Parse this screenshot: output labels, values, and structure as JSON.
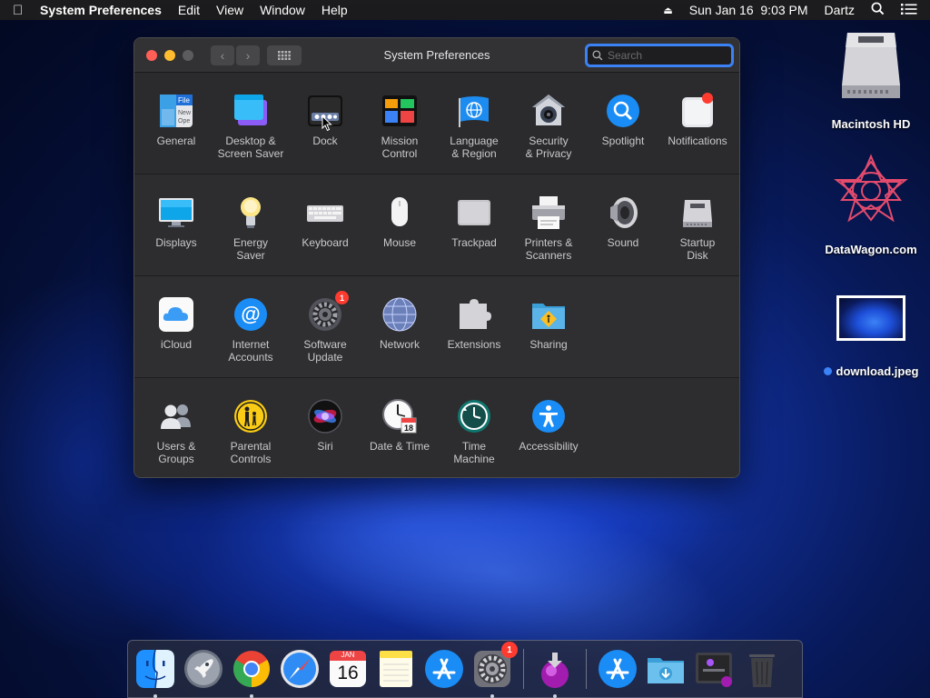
{
  "menubar": {
    "app_name": "System Preferences",
    "items": [
      "Edit",
      "View",
      "Window",
      "Help"
    ],
    "datetime": "Sun Jan 16  9:03 PM",
    "user": "Dartz"
  },
  "window": {
    "title": "System Preferences",
    "search_placeholder": "Search"
  },
  "panes": [
    {
      "label": "General"
    },
    {
      "label": "Desktop &\nScreen Saver"
    },
    {
      "label": "Dock"
    },
    {
      "label": "Mission\nControl"
    },
    {
      "label": "Language\n& Region"
    },
    {
      "label": "Security\n& Privacy"
    },
    {
      "label": "Spotlight"
    },
    {
      "label": "Notifications"
    },
    {
      "label": "Displays"
    },
    {
      "label": "Energy\nSaver"
    },
    {
      "label": "Keyboard"
    },
    {
      "label": "Mouse"
    },
    {
      "label": "Trackpad"
    },
    {
      "label": "Printers &\nScanners"
    },
    {
      "label": "Sound"
    },
    {
      "label": "Startup\nDisk"
    },
    {
      "label": "iCloud"
    },
    {
      "label": "Internet\nAccounts"
    },
    {
      "label": "Software\nUpdate",
      "badge": "1"
    },
    {
      "label": "Network"
    },
    {
      "label": "Extensions"
    },
    {
      "label": "Sharing"
    },
    {
      "label": "Users &\nGroups"
    },
    {
      "label": "Parental\nControls"
    },
    {
      "label": "Siri"
    },
    {
      "label": "Date & Time"
    },
    {
      "label": "Time\nMachine"
    },
    {
      "label": "Accessibility"
    }
  ],
  "desktop": {
    "hd_label": "Macintosh HD",
    "datawagon_label": "DataWagon.com",
    "file_label": "download.jpeg"
  },
  "dock": {
    "calendar_month": "JAN",
    "calendar_day": "16",
    "settings_badge": "1"
  },
  "colors": {
    "accent": "#3b82f6",
    "badge": "#ff3b30"
  }
}
